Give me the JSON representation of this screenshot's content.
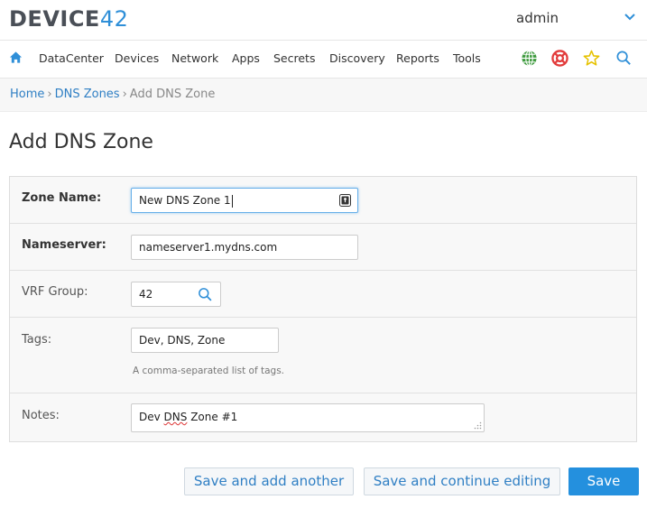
{
  "app": {
    "logo_text": "DEVICE",
    "logo_number": "42",
    "user": "admin",
    "accent_color": "#2f8fd8"
  },
  "nav": {
    "items": [
      "DataCenter",
      "Devices",
      "Network",
      "Apps",
      "Secrets",
      "Discovery",
      "Reports",
      "Tools"
    ],
    "icons": [
      "home-icon",
      "globe-icon",
      "lifebuoy-icon",
      "star-icon",
      "search-icon"
    ]
  },
  "breadcrumb": {
    "home": "Home",
    "section": "DNS Zones",
    "current": "Add DNS Zone",
    "separator": "›"
  },
  "page": {
    "title": "Add DNS Zone"
  },
  "form": {
    "zone_name": {
      "label": "Zone Name:",
      "value": "New DNS Zone 1"
    },
    "nameserver": {
      "label": "Nameserver:",
      "value": "nameserver1.mydns.com"
    },
    "vrf_group": {
      "label": "VRF Group:",
      "value": "42"
    },
    "tags": {
      "label": "Tags:",
      "value": "Dev, DNS, Zone",
      "help": "A comma-separated list of tags."
    },
    "notes": {
      "label": "Notes:",
      "value_pre": "Dev ",
      "value_word": "DNS",
      "value_post": " Zone #1"
    }
  },
  "actions": {
    "save_add": "Save and add another",
    "save_continue": "Save and continue editing",
    "save": "Save"
  }
}
